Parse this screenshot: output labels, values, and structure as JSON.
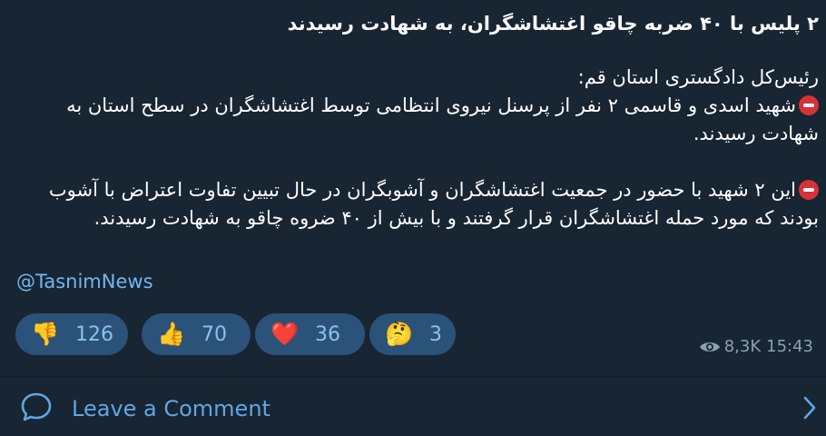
{
  "post": {
    "title": "۲ پلیس با ۴۰ ضربه چاقو اغتشاشگران، به شهادت رسیدند",
    "intro": "رئیس‌کل دادگستری استان قم:",
    "paragraph1": "شهید اسدی و قاسمی ۲ نفر از پرسنل نیروی انتظامی توسط اغتشاشگران در سطح استان به شهادت رسیدند.",
    "paragraph2": "این ۲ شهید با حضور در جمعیت اغتشاشگران و آشوبگران در حال تبیین تفاوت اعتراض با آشوب بودند که مورد حمله اغتشاشگران قرار گرفتند و با بیش از ۴۰ ضروه چاقو به شهادت رسیدند.",
    "handle": "@TasnimNews"
  },
  "reactions": [
    {
      "emoji": "👎",
      "icon": "thumbs-down-icon",
      "count": "126"
    },
    {
      "emoji": "👍",
      "icon": "thumbs-up-icon",
      "count": "70"
    },
    {
      "emoji": "❤️",
      "icon": "heart-icon",
      "count": "36"
    },
    {
      "emoji": "🤔",
      "icon": "thinking-face-icon",
      "count": "3"
    }
  ],
  "meta": {
    "views": "8,3K",
    "time": "15:43"
  },
  "comments": {
    "label": "Leave a Comment"
  },
  "colors": {
    "background": "#17212b",
    "link": "#73b6f0",
    "reaction_pill": "#2b5278",
    "news_icon": "#d8313a"
  }
}
